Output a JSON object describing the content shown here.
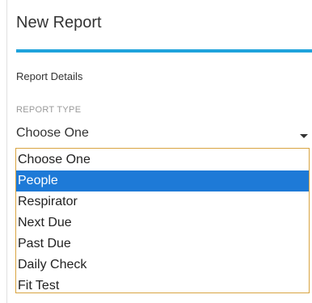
{
  "panel": {
    "title": "New Report",
    "section_heading": "Report Details"
  },
  "report_type": {
    "label": "REPORT TYPE",
    "selected_value": "Choose One",
    "options": [
      {
        "label": "Choose One",
        "highlighted": false
      },
      {
        "label": "People",
        "highlighted": true
      },
      {
        "label": "Respirator",
        "highlighted": false
      },
      {
        "label": "Next Due",
        "highlighted": false
      },
      {
        "label": "Past Due",
        "highlighted": false
      },
      {
        "label": "Daily Check",
        "highlighted": false
      },
      {
        "label": "Fit Test",
        "highlighted": false
      }
    ]
  },
  "colors": {
    "accent": "#1fa3dc",
    "highlight": "#1e7ad7",
    "listbox_border": "#d9a441"
  },
  "icons": {
    "dropdown": "caret-down-icon"
  }
}
